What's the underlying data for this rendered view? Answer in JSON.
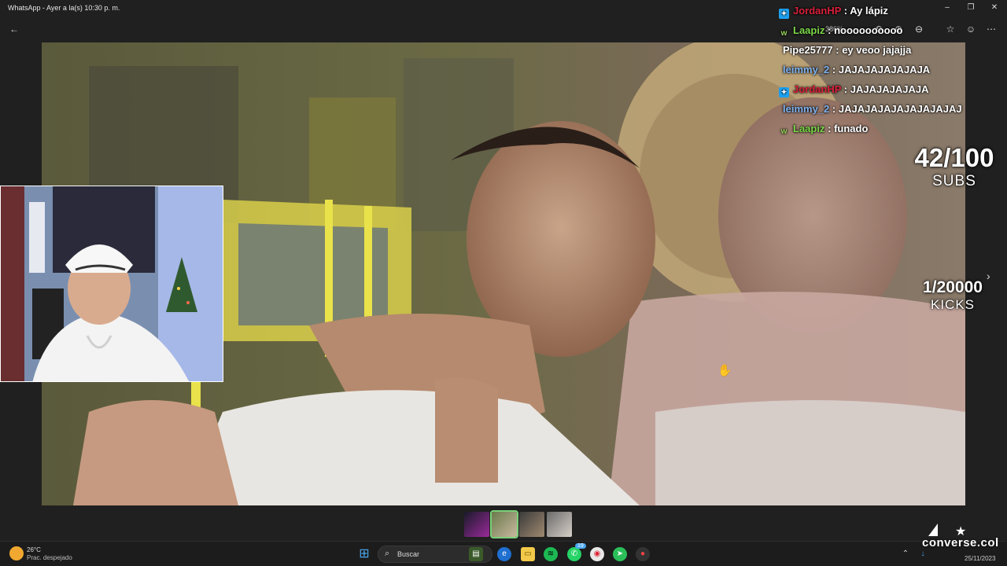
{
  "window": {
    "title": "WhatsApp - Ayer a la(s) 10:30 p. m.",
    "minimize_glyph": "–",
    "restore_glyph": "❐",
    "close_glyph": "✕"
  },
  "toolbar": {
    "zoom_level": "386%",
    "icons": [
      "back-arrow-icon",
      "rotate-icon",
      "zoom-in-icon",
      "zoom-out-icon",
      "star-icon",
      "emoji-icon",
      "more-icon"
    ]
  },
  "chat": [
    {
      "badge": "kick",
      "user": "JordanHP",
      "color": "#d8203a",
      "message": "Ay lápiz"
    },
    {
      "badge": "w",
      "user": "Laapiz",
      "color": "#7cd84a",
      "message": "noooooooooo"
    },
    {
      "badge": "",
      "user": "Pipe25777",
      "color": "#ffffff",
      "message": "ey veoo jajajja"
    },
    {
      "badge": "",
      "user": "leimmy_2",
      "color": "#7fb2ef",
      "message": "JAJAJAJAJAJAJA"
    },
    {
      "badge": "kick",
      "user": "JordanHP",
      "color": "#d8203a",
      "message": "JAJAJAJAJAJA"
    },
    {
      "badge": "",
      "user": "leimmy_2",
      "color": "#7fb2ef",
      "message": "JAJAJAJAJAJAJAJAJAJ"
    },
    {
      "badge": "w",
      "user": "Laapiz",
      "color": "#7cd84a",
      "message": "funado"
    }
  ],
  "chat_separator": ":",
  "counters": {
    "subs": {
      "value": "42/100",
      "label": "SUBS"
    },
    "kicks": {
      "value": "1/20000",
      "label": "KICKS"
    }
  },
  "taskbar": {
    "weather_temp": "26°C",
    "weather_desc": "Prac. despejado",
    "search_label": "Buscar",
    "whatsapp_badge": "19",
    "date": "25/11/2023"
  },
  "brand": {
    "name": "converse.col"
  },
  "colors": {
    "accent_thumb": "#7ad07a",
    "kick_badge": "#1da1f2"
  }
}
